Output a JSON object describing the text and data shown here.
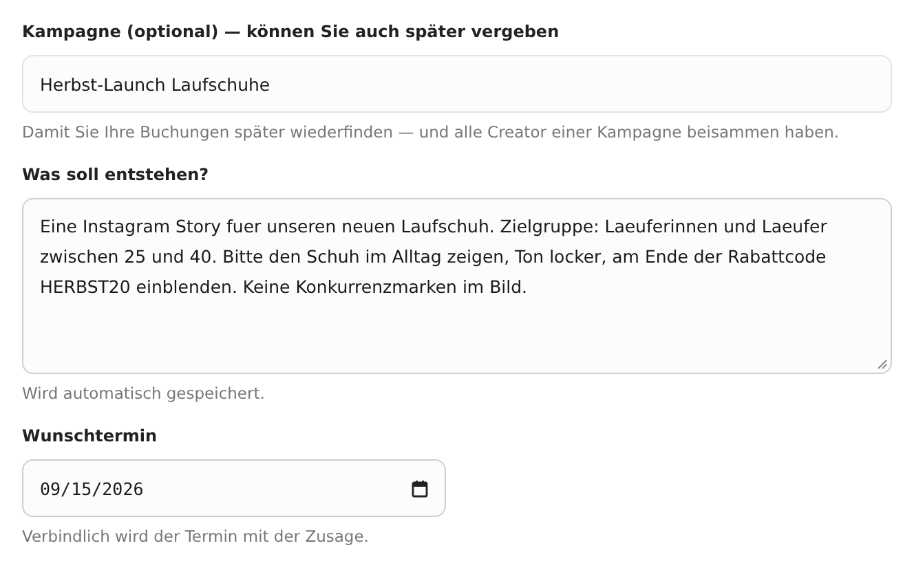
{
  "campaign": {
    "label": "Kampagne (optional) — können Sie auch später vergeben",
    "value": "Herbst-Launch Laufschuhe",
    "hint": "Damit Sie Ihre Buchungen später wiederfinden — und alle Creator einer Kampagne beisammen haben."
  },
  "brief": {
    "label": "Was soll entstehen?",
    "value": "Eine Instagram Story fuer unseren neuen Laufschuh. Zielgruppe: Laeuferinnen und Laeufer zwischen 25 und 40. Bitte den Schuh im Alltag zeigen, Ton locker, am Ende der Rabattcode HERBST20 einblenden. Keine Konkurrenzmarken im Bild.",
    "hint": "Wird automatisch gespeichert."
  },
  "date": {
    "label": "Wunschtermin",
    "value": "09/15/2026",
    "hint": "Verbindlich wird der Termin mit der Zusage."
  }
}
